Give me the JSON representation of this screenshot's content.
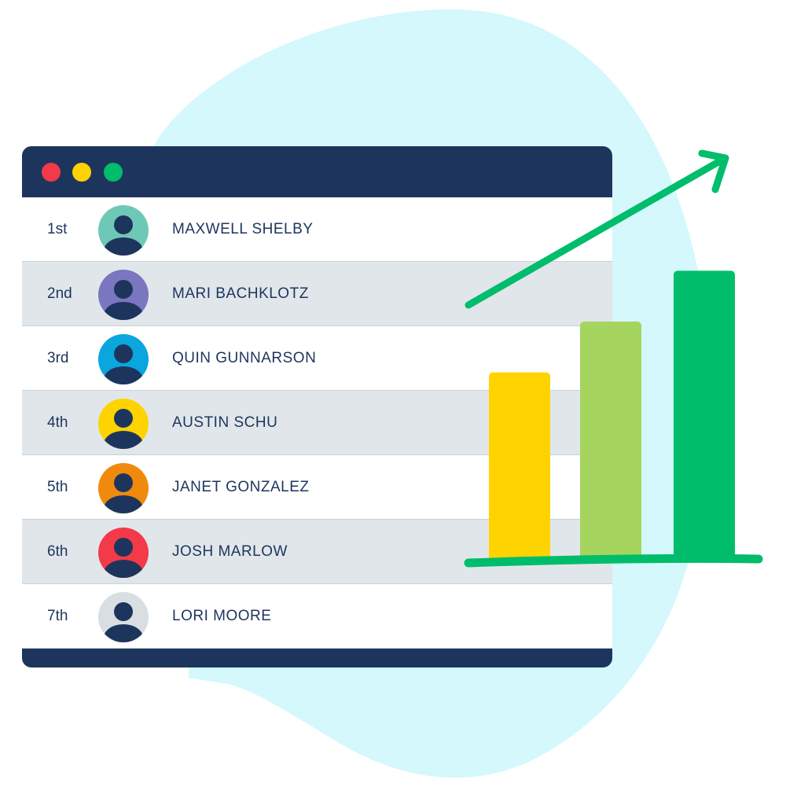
{
  "colors": {
    "backdrop_blob": "#d4f8fc",
    "window_frame": "#1d355d",
    "row_light": "#ffffff",
    "row_shaded": "#e1e6ea",
    "text": "#1d355d",
    "window_close": "#f33a48",
    "window_minimize": "#ffd300",
    "window_maximize": "#00bd6b",
    "arrow_and_baseline": "#00bd6b"
  },
  "window_controls": [
    "close-dot",
    "minimize-dot",
    "maximize-dot"
  ],
  "leaderboard": [
    {
      "rank": "1st",
      "name": "MAXWELL SHELBY",
      "avatar_color": "#6ec8b7",
      "avatar_icon": "user-icon"
    },
    {
      "rank": "2nd",
      "name": "MARI BACHKLOTZ",
      "avatar_color": "#7a76bf",
      "avatar_icon": "user-icon"
    },
    {
      "rank": "3rd",
      "name": "QUIN GUNNARSON",
      "avatar_color": "#0aa6de",
      "avatar_icon": "user-icon"
    },
    {
      "rank": "4th",
      "name": "AUSTIN SCHU",
      "avatar_color": "#ffd300",
      "avatar_icon": "user-icon"
    },
    {
      "rank": "5th",
      "name": "JANET GONZALEZ",
      "avatar_color": "#f08a0c",
      "avatar_icon": "user-icon"
    },
    {
      "rank": "6th",
      "name": "JOSH MARLOW",
      "avatar_color": "#f33a48",
      "avatar_icon": "user-icon"
    },
    {
      "rank": "7th",
      "name": "LORI MOORE",
      "avatar_color": "#d9dee2",
      "avatar_icon": "user-icon"
    }
  ],
  "chart_data": {
    "type": "bar",
    "title": "",
    "xlabel": "",
    "ylabel": "",
    "categories": [
      "",
      "",
      ""
    ],
    "values": [
      0.63,
      0.8,
      0.97
    ],
    "value_scale": "relative height, unlabeled",
    "bar_colors": [
      "#ffd300",
      "#a5d55e",
      "#00bd6b"
    ],
    "trend_arrow": "up-right",
    "grid": false,
    "legend": "none"
  }
}
